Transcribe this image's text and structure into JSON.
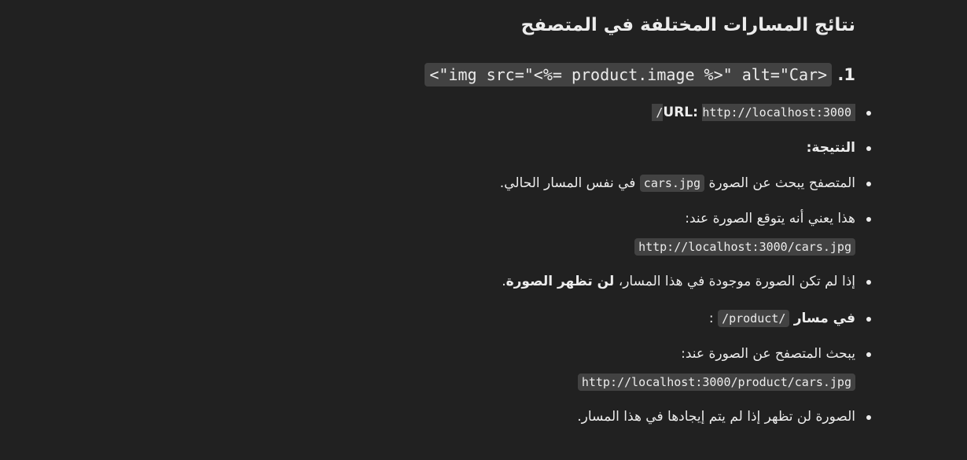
{
  "heading": "نتائج المسارات المختلفة في المتصفح",
  "item1": {
    "number": "1.",
    "code": "<img src=\"<%= product.image %>\" alt=\"Car\">"
  },
  "bullets": {
    "url_label": "URL:",
    "url_code": "http://localhost:3000/",
    "result_label": "النتيجة:",
    "search_pre": "المتصفح يبحث عن الصورة",
    "search_code": "cars.jpg",
    "search_post": "في نفس المسار الحالي.",
    "expect_text": "هذا يعني أنه يتوقع الصورة عند:",
    "expect_code": "http://localhost:3000/cars.jpg",
    "missing_pre": "إذا لم تكن الصورة موجودة في هذا المسار،",
    "missing_bold": "لن تظهر الصورة",
    "missing_end": ".",
    "product_label": "في مسار",
    "product_code": "/product/",
    "product_colon": ":",
    "product_search_text": "يبحث المتصفح عن الصورة عند:",
    "product_search_code": "http://localhost:3000/product/cars.jpg",
    "final_text": "الصورة لن تظهر إذا لم يتم إيجادها في هذا المسار."
  }
}
